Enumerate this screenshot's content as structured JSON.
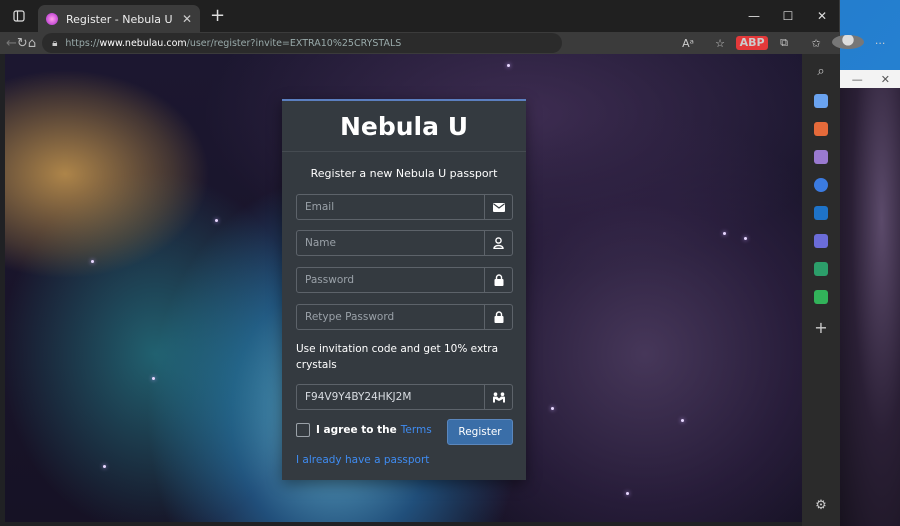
{
  "browser": {
    "tab_title": "Register - Nebula U",
    "url_prefix": "https://",
    "url_host": "www.nebulau.com",
    "url_path": "/user/register?invite=EXTRA10%25CRYSTALS",
    "abp_label": "ABP"
  },
  "form": {
    "site_title": "Nebula U",
    "subtitle": "Register a new Nebula U passport",
    "email_placeholder": "Email",
    "name_placeholder": "Name",
    "password_placeholder": "Password",
    "retype_placeholder": "Retype Password",
    "invite_text": "Use invitation code and get 10% extra crystals",
    "invite_code": "F94V9Y4BY24HKJ2M",
    "agree_label": "I agree to the",
    "terms_link": "Terms",
    "register_button": "Register",
    "have_passport_link": "I already have a passport"
  },
  "colors": {
    "card_bg": "#343a40",
    "accent_link": "#3f8cf2",
    "button_bg": "#3a6ea8"
  }
}
